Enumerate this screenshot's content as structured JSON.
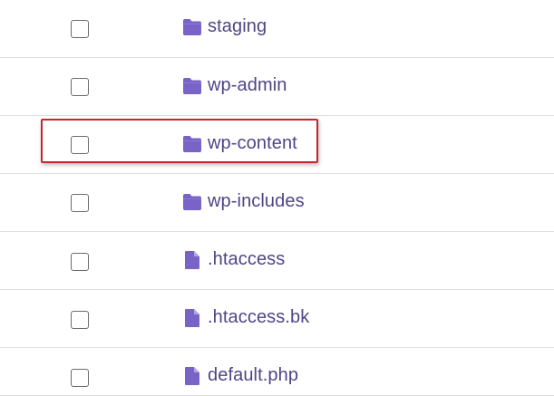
{
  "colors": {
    "accent": "#7a63c7",
    "label": "#4f4485",
    "divider": "#dedede",
    "highlight": "#c4272c"
  },
  "file_list": {
    "items": [
      {
        "name": "staging",
        "type": "folder",
        "icon": "folder-icon",
        "checked": false
      },
      {
        "name": "wp-admin",
        "type": "folder",
        "icon": "folder-icon",
        "checked": false
      },
      {
        "name": "wp-content",
        "type": "folder",
        "icon": "folder-icon",
        "checked": false,
        "highlighted": true
      },
      {
        "name": "wp-includes",
        "type": "folder",
        "icon": "folder-icon",
        "checked": false
      },
      {
        "name": ".htaccess",
        "type": "file",
        "icon": "file-icon",
        "checked": false
      },
      {
        "name": ".htaccess.bk",
        "type": "file",
        "icon": "file-icon",
        "checked": false
      },
      {
        "name": "default.php",
        "type": "file",
        "icon": "file-icon",
        "checked": false
      }
    ]
  }
}
